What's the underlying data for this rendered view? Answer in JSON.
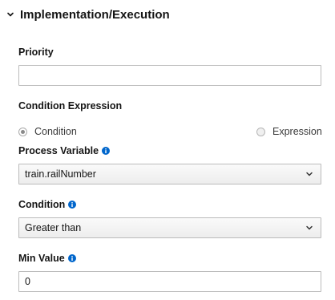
{
  "section": {
    "title": "Implementation/Execution",
    "expanded": true
  },
  "priority": {
    "label": "Priority",
    "value": ""
  },
  "condition_expression": {
    "label": "Condition Expression",
    "options": [
      {
        "label": "Condition",
        "selected": true
      },
      {
        "label": "Expression",
        "selected": false
      }
    ]
  },
  "process_variable": {
    "label": "Process Variable",
    "selected": "train.railNumber"
  },
  "condition": {
    "label": "Condition",
    "selected": "Greater than"
  },
  "min_value": {
    "label": "Min Value",
    "value": "0"
  },
  "colors": {
    "info_icon": "#0066cc",
    "border": "#bbbbbb",
    "text": "#151515"
  }
}
